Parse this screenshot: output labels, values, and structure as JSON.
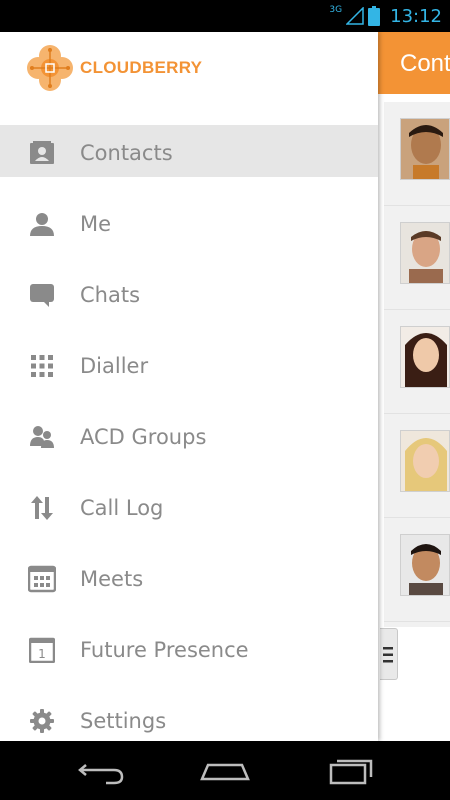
{
  "status_bar": {
    "network": "3G",
    "time": "13:12"
  },
  "brand": {
    "name": "CLOUDBERRY",
    "accent": "#f39335"
  },
  "drawer": {
    "items": [
      {
        "label": "Contacts",
        "icon": "contact-card-icon",
        "selected": true
      },
      {
        "label": "Me",
        "icon": "person-icon"
      },
      {
        "label": "Chats",
        "icon": "chat-bubble-icon"
      },
      {
        "label": "Dialler",
        "icon": "dialpad-icon"
      },
      {
        "label": "ACD Groups",
        "icon": "group-icon"
      },
      {
        "label": "Call Log",
        "icon": "up-down-arrows-icon"
      },
      {
        "label": "Meets",
        "icon": "calendar-grid-icon"
      },
      {
        "label": "Future Presence",
        "icon": "calendar-day-icon"
      },
      {
        "label": "Settings",
        "icon": "gear-icon"
      }
    ]
  },
  "background_screen": {
    "title": "Cont"
  },
  "nav_bar": {
    "buttons": [
      "back-icon",
      "home-icon",
      "recent-apps-icon"
    ]
  }
}
